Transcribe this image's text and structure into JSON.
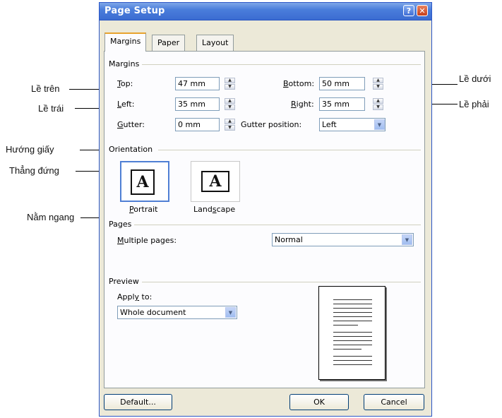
{
  "dialog": {
    "title": "Page Setup",
    "help_button": "?",
    "close_button": "✕"
  },
  "tabs": [
    {
      "label": "Margins",
      "active": true
    },
    {
      "label": "Paper",
      "active": false
    },
    {
      "label": "Layout",
      "active": false
    }
  ],
  "margins": {
    "group_label": "Margins",
    "top": {
      "label": "Top:",
      "value": "47 mm"
    },
    "left": {
      "label": "Left:",
      "value": "35 mm"
    },
    "gutter": {
      "label": "Gutter:",
      "value": "0 mm"
    },
    "bottom": {
      "label": "Bottom:",
      "value": "50 mm"
    },
    "right": {
      "label": "Right:",
      "value": "35 mm"
    },
    "gutter_position": {
      "label": "Gutter position:",
      "value": "Left"
    }
  },
  "orientation": {
    "group_label": "Orientation",
    "portrait_label": "Portrait",
    "landscape_label": "Landscape",
    "glyph": "A",
    "selected": "portrait"
  },
  "pages": {
    "group_label": "Pages",
    "multiple_label": "Multiple pages:",
    "multiple_value": "Normal"
  },
  "preview": {
    "group_label": "Preview",
    "apply_to_label": "Apply to:",
    "apply_to_value": "Whole document"
  },
  "buttons": {
    "default": "Default...",
    "ok": "OK",
    "cancel": "Cancel"
  },
  "callouts": {
    "le_tren": "Lề trên",
    "le_trai": "Lề trái",
    "huong_giay": "Hướng giấy",
    "thang_dung": "Thẳng đứng",
    "nam_ngang": "Nằm ngang",
    "le_duoi": "Lề dưới",
    "le_phai": "Lề phải"
  },
  "colors": {
    "titlebar": "#3b6cd1",
    "dialog_bg": "#ece9d8",
    "active_tab_accent": "#e8a32e",
    "selection_border": "#4f7fd4"
  }
}
